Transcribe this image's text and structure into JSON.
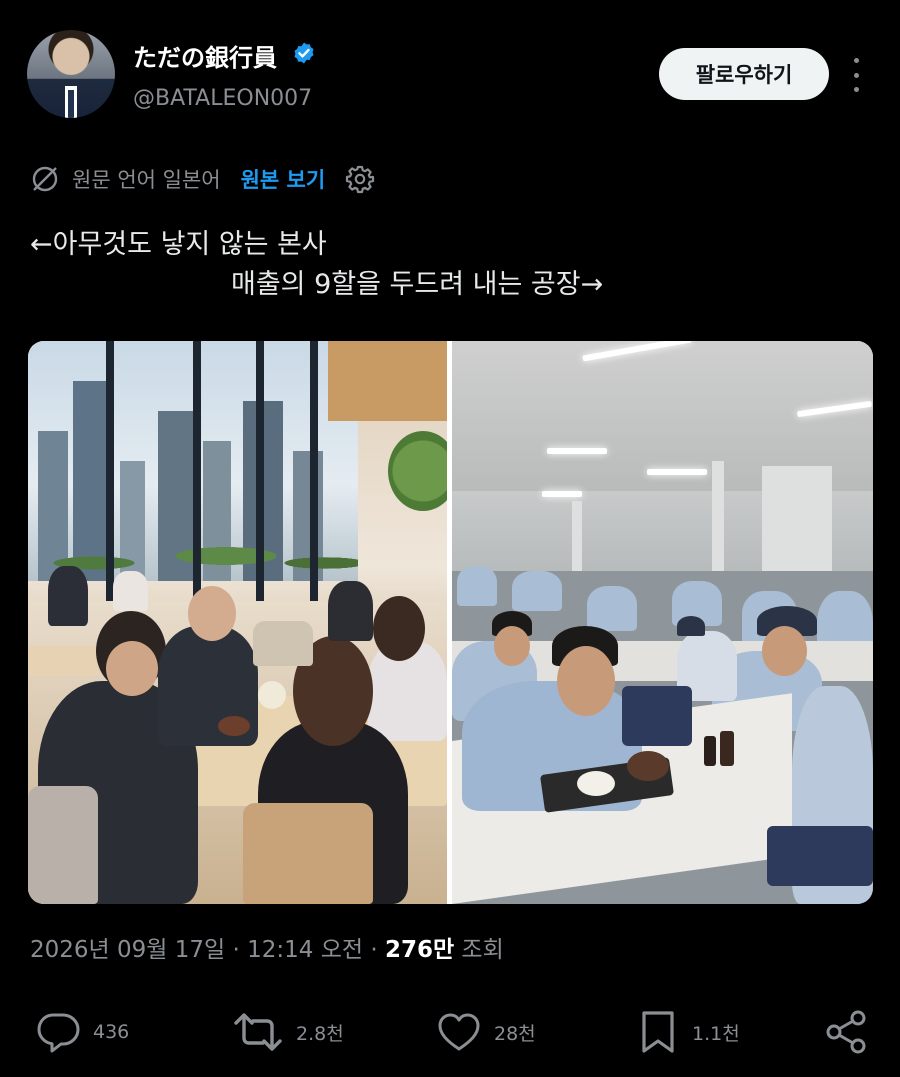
{
  "author": {
    "display_name": "ただの銀行員",
    "handle": "@BATALEON007",
    "verified": true,
    "avatar_icon": "profile-photo"
  },
  "follow_button": {
    "label": "팔로우하기"
  },
  "translation": {
    "language_text": "원문 언어 일본어",
    "show_original_label": "원본 보기"
  },
  "tweet": {
    "line1": "←아무것도 낳지 않는 본사",
    "line2": "매출의 9할을 두드려 내는 공장→"
  },
  "media": {
    "left_image": "modern-office-cafeteria-photo",
    "right_image": "factory-cafeteria-photo"
  },
  "meta": {
    "datetime": "2026년 09월 17일 · 12:14 오전 · ",
    "views_count": "276만",
    "views_label": " 조회"
  },
  "actions": {
    "replies": "436",
    "reposts": "2.8천",
    "likes": "28천",
    "bookmarks": "1.1천"
  },
  "colors": {
    "background": "#000000",
    "accent": "#1d9bf0",
    "text_primary": "#e7e9ea",
    "text_secondary": "#8b8f94"
  }
}
